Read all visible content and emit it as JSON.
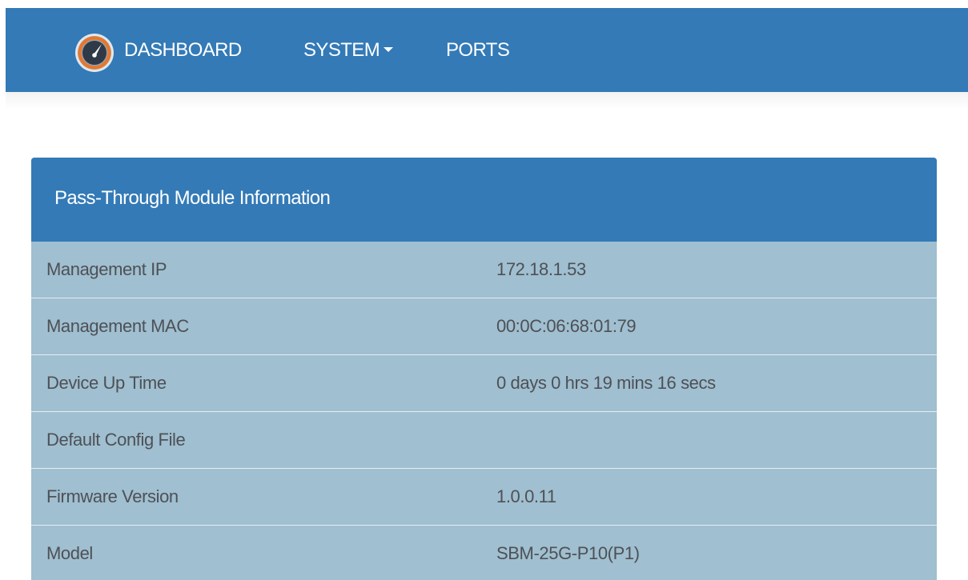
{
  "navbar": {
    "brand_icon": "speedometer-icon",
    "links": [
      {
        "label": "DASHBOARD"
      },
      {
        "label": "SYSTEM",
        "has_dropdown": true
      },
      {
        "label": "PORTS"
      }
    ],
    "background": "#337ab7"
  },
  "panel": {
    "title": "Pass-Through Module Information",
    "rows": [
      {
        "label": "Management IP",
        "value": "172.18.1.53"
      },
      {
        "label": "Management MAC",
        "value": "00:0C:06:68:01:79"
      },
      {
        "label": "Device Up Time",
        "value": "0 days 0 hrs 19 mins 16 secs"
      },
      {
        "label": "Default Config File",
        "value": ""
      },
      {
        "label": "Firmware Version",
        "value": "1.0.0.11"
      },
      {
        "label": "Model",
        "value": "SBM-25G-P10(P1)"
      }
    ],
    "heading_color": "#337ab7",
    "body_color": "#a0bfd0"
  }
}
